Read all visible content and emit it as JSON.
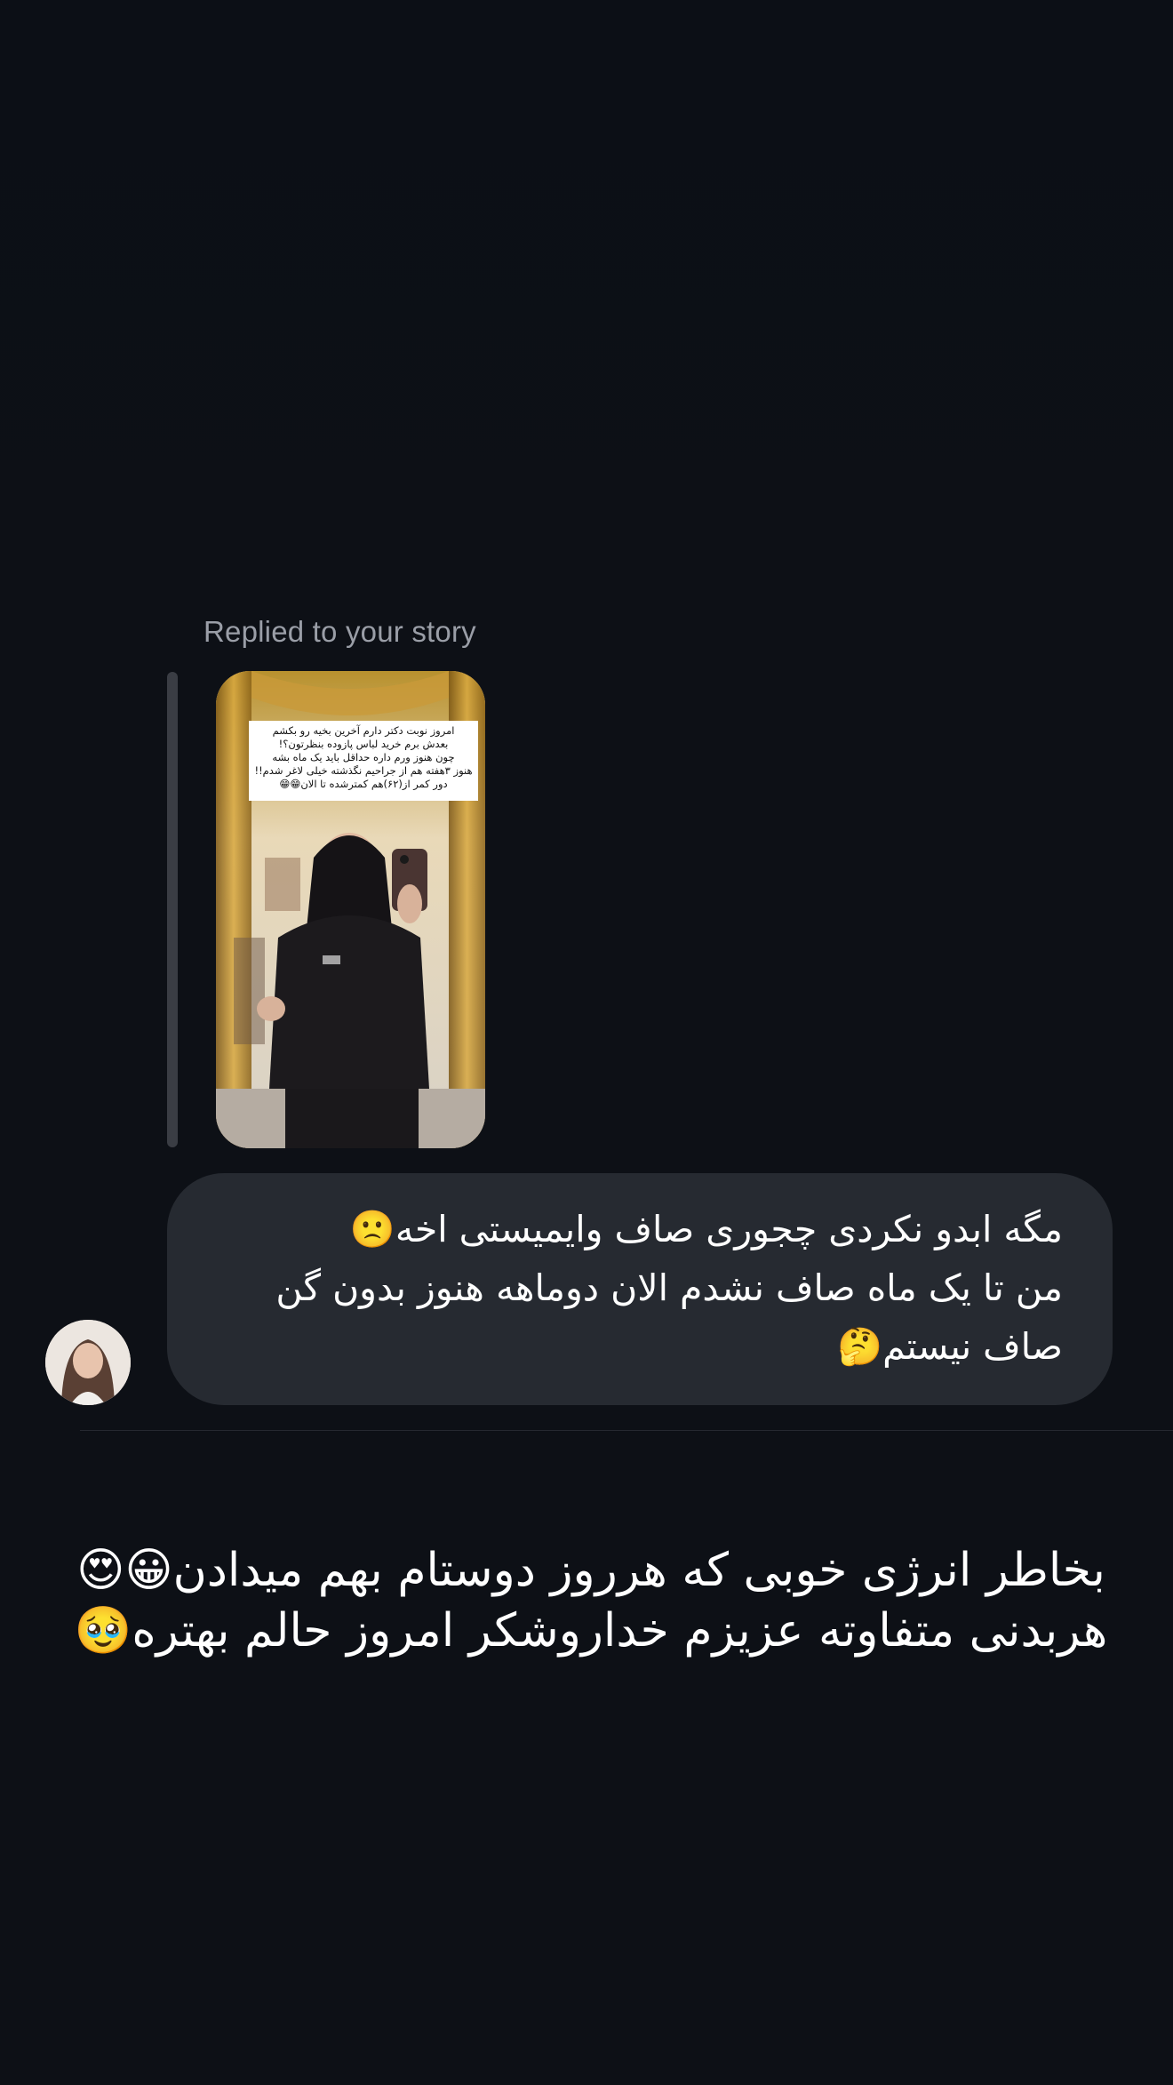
{
  "thread": {
    "replied_label": "Replied to your story",
    "story": {
      "overlay_text_lines": [
        "امروز نوبت دکتر دارم آخرین بخیه رو بکشم",
        "بعدش برم خرید لباس پازوده بنظرتون؟!",
        "چون هنوز ورم داره حداقل باید یک ماه بشه",
        "هنوز ۳هفته هم از جراحیم نگذشته خیلی لاغر شدم!!",
        "دور کمر از(۶۲)هم کمترشده تا الان😁😁"
      ],
      "icon": "story-thumbnail-image"
    },
    "message": {
      "lines": [
        "مگه ابدو نکردی چجوری صاف وایمیستی اخه🙁",
        "من تا یک ماه صاف نشدم الان دوماهه هنوز بدون گن",
        "صاف نیستم🤔"
      ]
    },
    "avatar_icon": "profile-avatar"
  },
  "caption": {
    "lines": [
      "بخاطر انرژی خوبی که هرروز دوستام بهم میدادن😀😍",
      "هربدنی متفاوته عزیزم خداروشکر امروز حالم بهتره🥹"
    ]
  },
  "colors": {
    "background": "#0d1016",
    "bubble": "#262a31",
    "label": "#9a9ea7",
    "reply_bar": "#3a3d44"
  }
}
